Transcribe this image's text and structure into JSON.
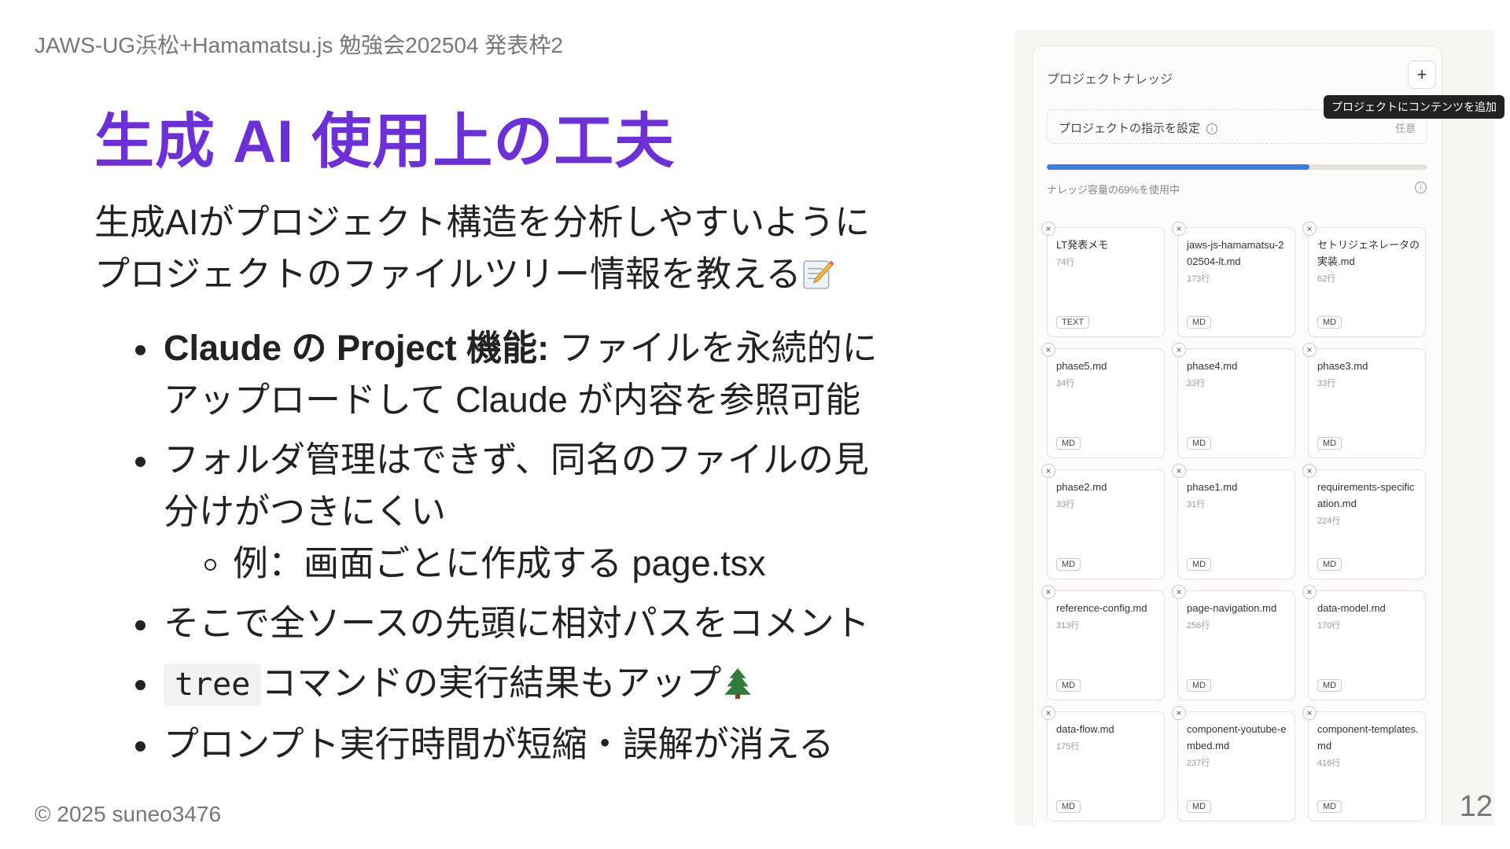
{
  "header": {
    "event": "JAWS-UG浜松+Hamamatsu.js 勉強会202504 発表枠2"
  },
  "title": "生成 AI 使用上の工夫",
  "lead": "生成AIがプロジェクト構造を分析しやすいようにプロジェクトのファイルツリー情報を教える",
  "bullets": {
    "b1_bold": "Claude の Project 機能:",
    "b1_text": " ファイルを永続的にアップロードして Claude が内容を参照可能",
    "b2_text": "フォルダ管理はできず、同名のファイルの見分けがつきにくい",
    "b2_sub": "例：画面ごとに作成する page.tsx",
    "b3_text": "そこで全ソースの先頭に相対パスをコメント",
    "b4_code": "tree",
    "b4_text": "コマンドの実行結果もアップ",
    "b5_text": "プロンプト実行時間が短縮・誤解が消える"
  },
  "footer": {
    "copyright": "© 2025 suneo3476",
    "page": "12"
  },
  "panel": {
    "heading": "プロジェクトナレッジ",
    "add_label": "+",
    "tooltip": "プロジェクトにコンテンツを追加",
    "instructions_label": "プロジェクトの指示を設定",
    "instructions_optional": "任意",
    "usage_text": "ナレッジ容量の69%を使用中",
    "usage_percent": 69,
    "close_label": "×",
    "info_label": "i",
    "files": [
      {
        "name": "LT発表メモ",
        "lines": "74行",
        "type": "TEXT"
      },
      {
        "name": "jaws-js-hamamatsu-202504-lt.md",
        "lines": "173行",
        "type": "MD"
      },
      {
        "name": "セトリジェネレータの実装.md",
        "lines": "62行",
        "type": "MD"
      },
      {
        "name": "phase5.md",
        "lines": "34行",
        "type": "MD"
      },
      {
        "name": "phase4.md",
        "lines": "33行",
        "type": "MD"
      },
      {
        "name": "phase3.md",
        "lines": "33行",
        "type": "MD"
      },
      {
        "name": "phase2.md",
        "lines": "33行",
        "type": "MD"
      },
      {
        "name": "phase1.md",
        "lines": "31行",
        "type": "MD"
      },
      {
        "name": "requirements-specification.md",
        "lines": "224行",
        "type": "MD"
      },
      {
        "name": "reference-config.md",
        "lines": "313行",
        "type": "MD"
      },
      {
        "name": "page-navigation.md",
        "lines": "256行",
        "type": "MD"
      },
      {
        "name": "data-model.md",
        "lines": "170行",
        "type": "MD"
      },
      {
        "name": "data-flow.md",
        "lines": "175行",
        "type": "MD"
      },
      {
        "name": "component-youtube-embed.md",
        "lines": "237行",
        "type": "MD"
      },
      {
        "name": "component-templates.md",
        "lines": "416行",
        "type": "MD"
      }
    ]
  }
}
